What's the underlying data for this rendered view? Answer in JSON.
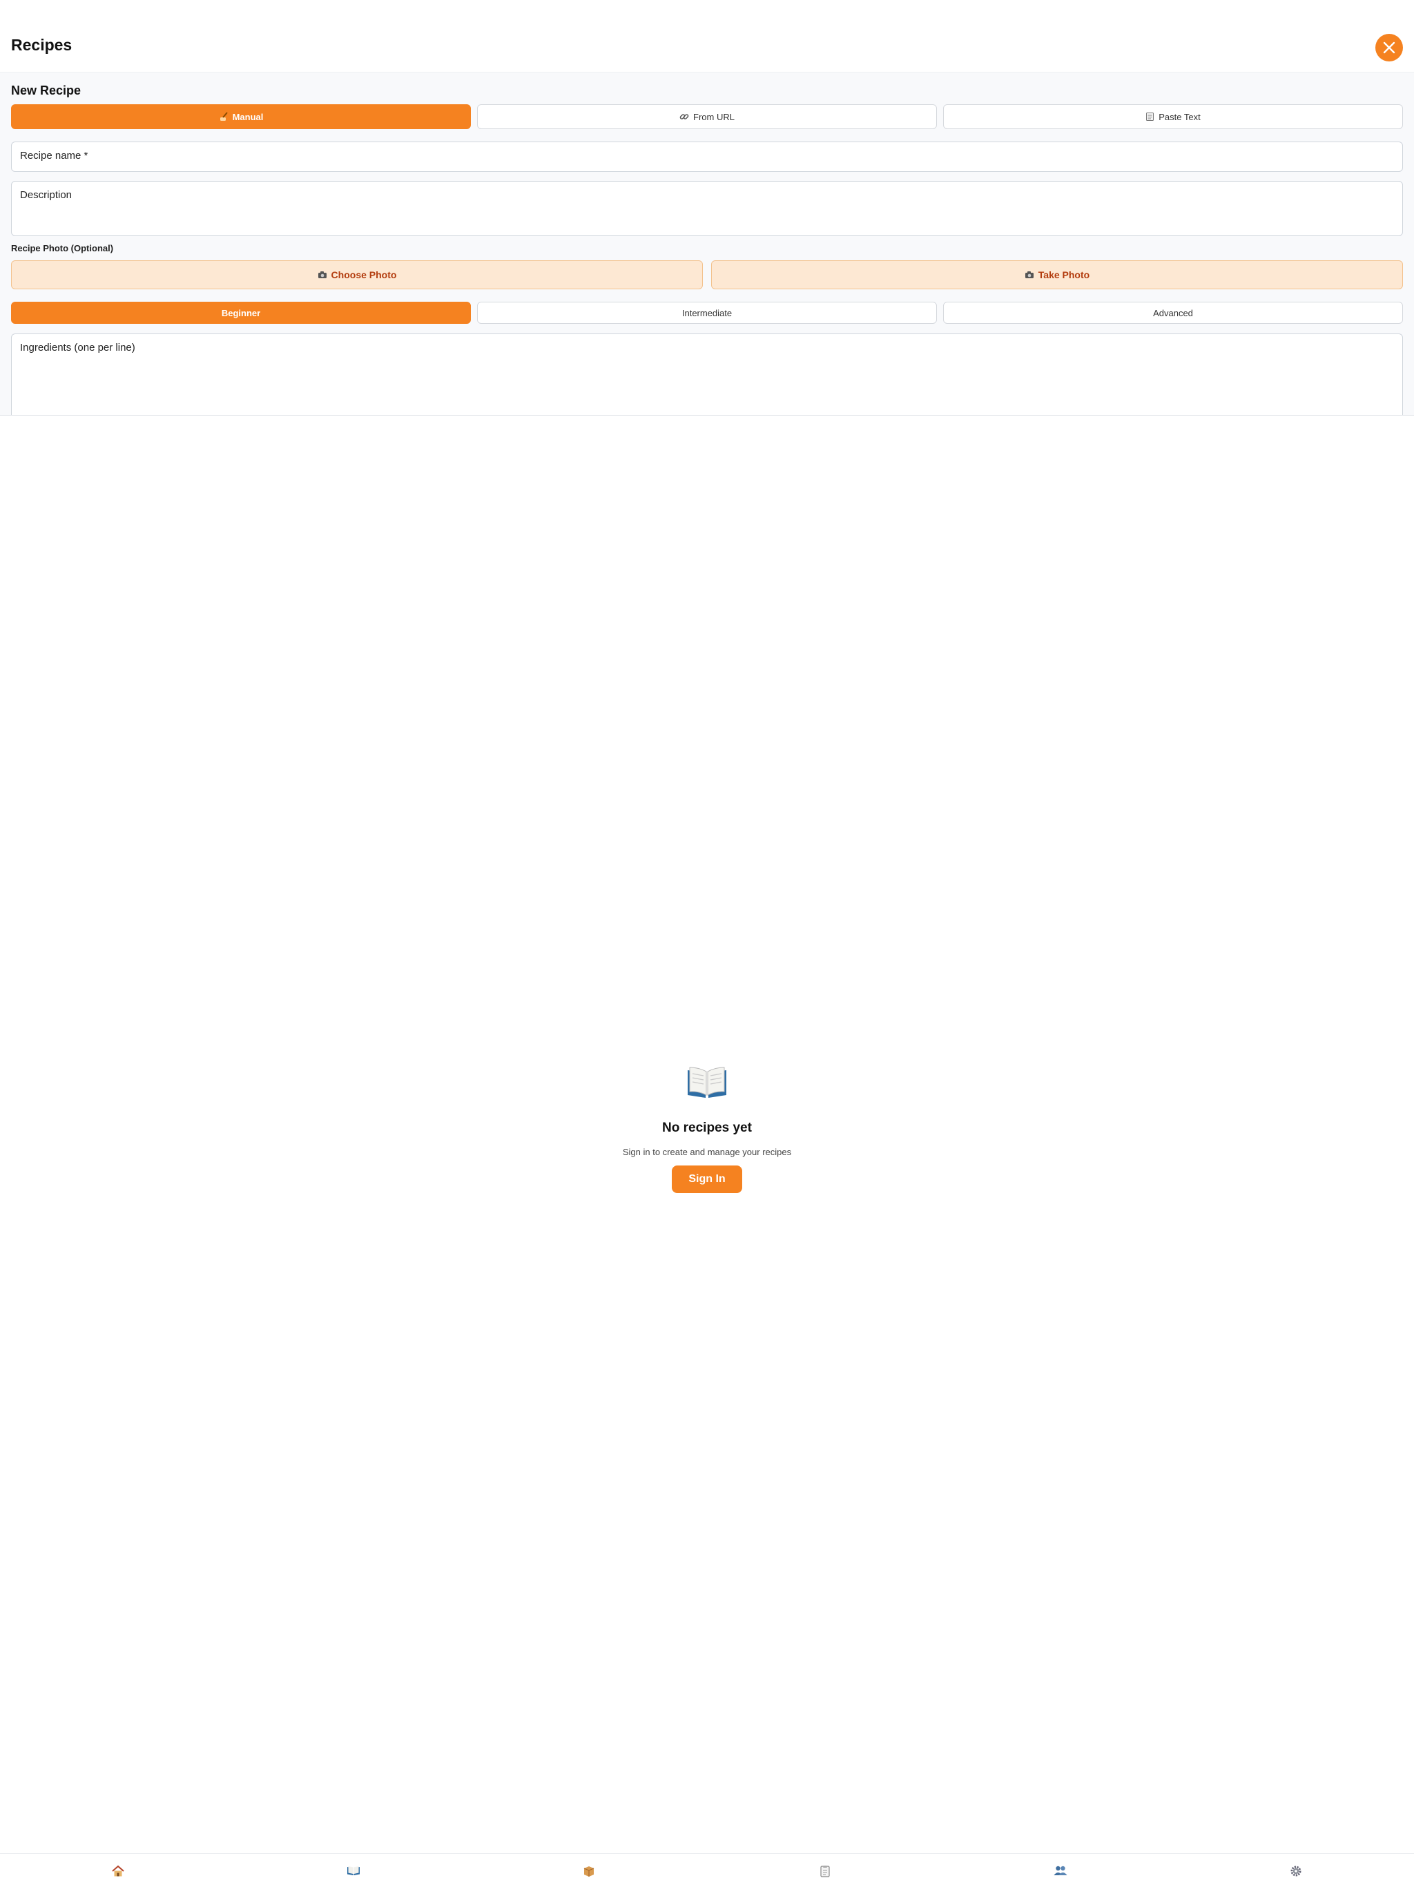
{
  "header": {
    "title": "Recipes"
  },
  "colors": {
    "accent": "#f58220",
    "photo_bg": "#fde8d3",
    "photo_text": "#b33c0e"
  },
  "form": {
    "title": "New Recipe",
    "modes": [
      {
        "label": "Manual",
        "icon": "writing-hand-icon",
        "active": true
      },
      {
        "label": "From URL",
        "icon": "link-icon",
        "active": false
      },
      {
        "label": "Paste Text",
        "icon": "notepad-icon",
        "active": false
      }
    ],
    "name_placeholder": "Recipe name *",
    "description_placeholder": "Description",
    "photo_label": "Recipe Photo (Optional)",
    "choose_photo": "Choose Photo",
    "take_photo": "Take Photo",
    "levels": [
      {
        "label": "Beginner",
        "active": true
      },
      {
        "label": "Intermediate",
        "active": false
      },
      {
        "label": "Advanced",
        "active": false
      }
    ],
    "ingredients_placeholder": "Ingredients (one per line)"
  },
  "empty_state": {
    "icon": "open-book-icon",
    "title": "No recipes yet",
    "subtitle": "Sign in to create and manage your recipes",
    "button": "Sign In"
  },
  "tabbar": {
    "items": [
      "home-icon",
      "book-icon",
      "pantry-icon",
      "list-icon",
      "people-icon",
      "gear-icon"
    ]
  }
}
